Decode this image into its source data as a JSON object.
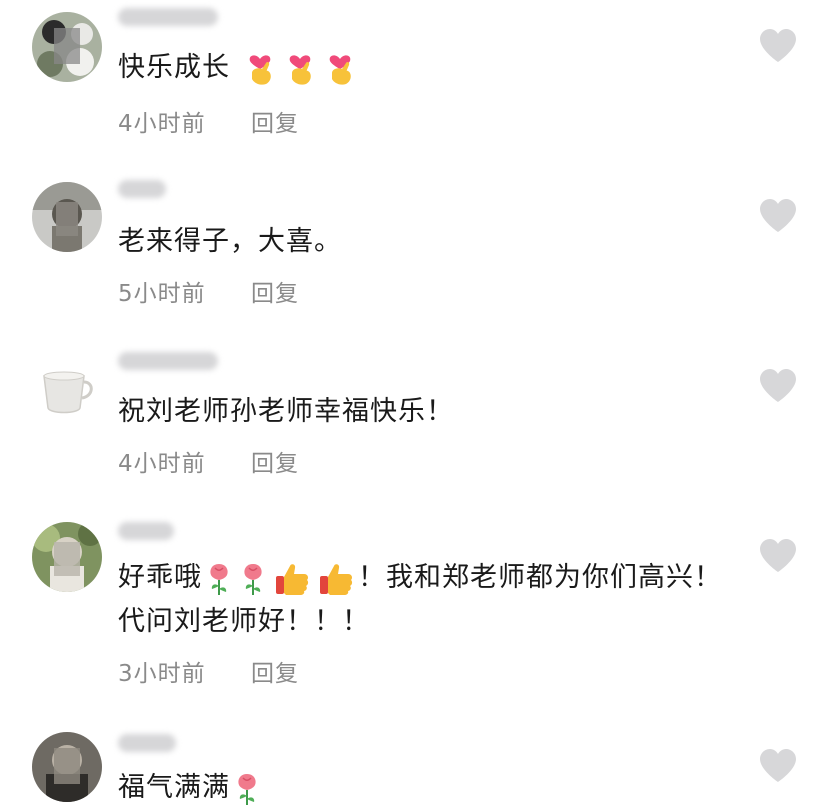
{
  "comments": [
    {
      "text": "快乐成长",
      "emoji": [
        "finger-heart",
        "finger-heart",
        "finger-heart"
      ],
      "time": "4小时前",
      "reply": "回复"
    },
    {
      "text": "老来得子，大喜。",
      "emoji": [],
      "time": "5小时前",
      "reply": "回复"
    },
    {
      "text": "祝刘老师孙老师幸福快乐！",
      "emoji": [],
      "time": "4小时前",
      "reply": "回复"
    },
    {
      "text_part1": "好乖哦",
      "emoji": [
        "rose",
        "rose",
        "thumbs-up",
        "thumbs-up"
      ],
      "text_part2": "！我和郑老师都为你们高兴！代问刘老师好！！！",
      "time": "3小时前",
      "reply": "回复"
    },
    {
      "text": "福气满满",
      "emoji": [
        "rose"
      ]
    }
  ],
  "icons": {
    "like": "heart-icon"
  },
  "colors": {
    "text": "#1a1a1a",
    "meta": "#8a8a8a",
    "like": "#d7d7d9"
  }
}
